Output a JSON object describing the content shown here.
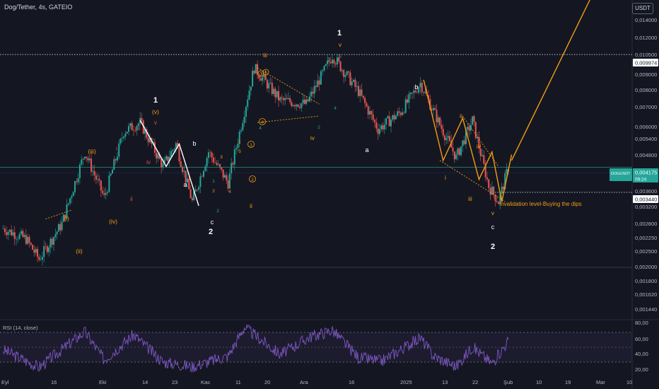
{
  "header": {
    "symbol_line": "Dog/Tether, 4s, GATEIO",
    "currency": "USDT"
  },
  "price_axis": {
    "ticks": [
      "0,014000",
      "0,012000",
      "0,010500",
      "0,009000",
      "0,008000",
      "0,007000",
      "0,006000",
      "0,005400",
      "0,004800",
      "0,003600",
      "0,003200",
      "0,002800",
      "0,002500",
      "0,002250",
      "0,002000",
      "0,001800",
      "0,001620",
      "0,001440"
    ],
    "tag_upper": "0,009974",
    "tag_current_symbol": "DOGUSDT",
    "tag_current": "0,004175",
    "tag_current_time": "09:24",
    "tag_lower": "0,003440"
  },
  "time_axis": [
    "Eyl",
    "16",
    "Eki",
    "14",
    "23",
    "Kas",
    "11",
    "20",
    "Ara",
    "16",
    "2025",
    "13",
    "22",
    "Şub",
    "10",
    "19",
    "Mar",
    "10"
  ],
  "rsi": {
    "title": "RSI (14, close)",
    "ticks": [
      "80,00",
      "60,00",
      "40,00",
      "20,00"
    ],
    "overbought": 70,
    "oversold": 30,
    "midline": 50
  },
  "wave_labels": {
    "white_top": [
      "1",
      "v",
      "1",
      "2",
      "c",
      "a",
      "2",
      "b",
      "b",
      "c",
      "a"
    ],
    "orange": [
      "(v)",
      "(iii)",
      "(iv)",
      "(i)",
      "(ii)",
      "iii",
      "ii",
      "iv",
      "v",
      "ii",
      "i",
      "iii",
      "iv",
      "v",
      "I",
      "I"
    ],
    "circled": [
      "1",
      "3",
      "2",
      "4",
      "5"
    ],
    "red": [
      "iii",
      "iv",
      "v",
      "i",
      "ii"
    ],
    "green_small": [
      "1",
      "2",
      "3",
      "4",
      "5",
      "2",
      "3",
      "4",
      "5",
      "2",
      "4"
    ]
  },
  "annotation": "Invalidation level-Buying the dips",
  "colors": {
    "background": "#141722",
    "candle_up": "#26a69a",
    "candle_down": "#ef5350",
    "wave_orange": "#f39c12",
    "wave_white": "#ffffff",
    "rsi_line": "#7e57c2",
    "price_tag_green": "#26a69a"
  },
  "chart_data": {
    "type": "line",
    "title": "Dog/Tether, 4s, GATEIO",
    "y_scale": "log",
    "ylim": [
      0.0013,
      0.0152
    ],
    "price_points": [
      {
        "date": "2024-09-02",
        "price": 0.0026
      },
      {
        "date": "2024-09-09",
        "price": 0.0024
      },
      {
        "date": "2024-09-13",
        "price": 0.00205
      },
      {
        "date": "2024-09-20",
        "price": 0.0027
      },
      {
        "date": "2024-09-27",
        "price": 0.0047
      },
      {
        "date": "2024-10-03",
        "price": 0.0033
      },
      {
        "date": "2024-10-09",
        "price": 0.0055
      },
      {
        "date": "2024-10-14",
        "price": 0.0059
      },
      {
        "date": "2024-10-21",
        "price": 0.0042
      },
      {
        "date": "2024-10-25",
        "price": 0.005
      },
      {
        "date": "2024-10-30",
        "price": 0.0032
      },
      {
        "date": "2024-11-04",
        "price": 0.0047
      },
      {
        "date": "2024-11-10",
        "price": 0.0037
      },
      {
        "date": "2024-11-18",
        "price": 0.009
      },
      {
        "date": "2024-11-26",
        "price": 0.007
      },
      {
        "date": "2024-12-04",
        "price": 0.0068
      },
      {
        "date": "2024-12-12",
        "price": 0.0099
      },
      {
        "date": "2024-12-20",
        "price": 0.0075
      },
      {
        "date": "2024-12-26",
        "price": 0.0056
      },
      {
        "date": "2025-01-02",
        "price": 0.0064
      },
      {
        "date": "2025-01-08",
        "price": 0.008
      },
      {
        "date": "2025-01-14",
        "price": 0.0058
      },
      {
        "date": "2025-01-19",
        "price": 0.0045
      },
      {
        "date": "2025-01-24",
        "price": 0.006
      },
      {
        "date": "2025-01-29",
        "price": 0.0036
      },
      {
        "date": "2025-02-01",
        "price": 0.0032
      },
      {
        "date": "2025-02-04",
        "price": 0.00417
      }
    ],
    "white_path_1": [
      {
        "date": "2024-10-14",
        "price": 0.006
      },
      {
        "date": "2024-10-22",
        "price": 0.0042
      },
      {
        "date": "2024-10-26",
        "price": 0.005
      },
      {
        "date": "2024-11-01",
        "price": 0.0031
      }
    ],
    "orange_path_2": [
      {
        "date": "2025-01-09",
        "price": 0.0082
      },
      {
        "date": "2025-01-15",
        "price": 0.0044
      },
      {
        "date": "2025-01-21",
        "price": 0.0061
      },
      {
        "date": "2025-01-26",
        "price": 0.0038
      },
      {
        "date": "2025-01-30",
        "price": 0.0047
      },
      {
        "date": "2025-02-02",
        "price": 0.0032
      },
      {
        "date": "2025-02-05",
        "price": 0.0046
      }
    ],
    "orange_projection": [
      {
        "date": "2025-02-05",
        "price": 0.0044
      },
      {
        "date": "2025-03-01",
        "price": 0.0152
      }
    ],
    "reference_levels": [
      {
        "price": 0.009974,
        "style": "dotted"
      },
      {
        "price": 0.00344,
        "style": "dotted"
      },
      {
        "price": 0.004175,
        "style": "solid"
      }
    ],
    "rsi_points": [
      {
        "date": "2024-09-02",
        "value": 48
      },
      {
        "date": "2024-09-13",
        "value": 25
      },
      {
        "date": "2024-09-27",
        "value": 72
      },
      {
        "date": "2024-10-03",
        "value": 35
      },
      {
        "date": "2024-10-12",
        "value": 68
      },
      {
        "date": "2024-10-21",
        "value": 32
      },
      {
        "date": "2024-10-30",
        "value": 26
      },
      {
        "date": "2024-11-10",
        "value": 40
      },
      {
        "date": "2024-11-15",
        "value": 78
      },
      {
        "date": "2024-11-26",
        "value": 42
      },
      {
        "date": "2024-12-05",
        "value": 65
      },
      {
        "date": "2024-12-12",
        "value": 74
      },
      {
        "date": "2024-12-20",
        "value": 38
      },
      {
        "date": "2024-12-27",
        "value": 33
      },
      {
        "date": "2025-01-08",
        "value": 64
      },
      {
        "date": "2025-01-12",
        "value": 40
      },
      {
        "date": "2025-01-19",
        "value": 26
      },
      {
        "date": "2025-01-24",
        "value": 52
      },
      {
        "date": "2025-01-30",
        "value": 30
      },
      {
        "date": "2025-02-04",
        "value": 60
      }
    ]
  }
}
